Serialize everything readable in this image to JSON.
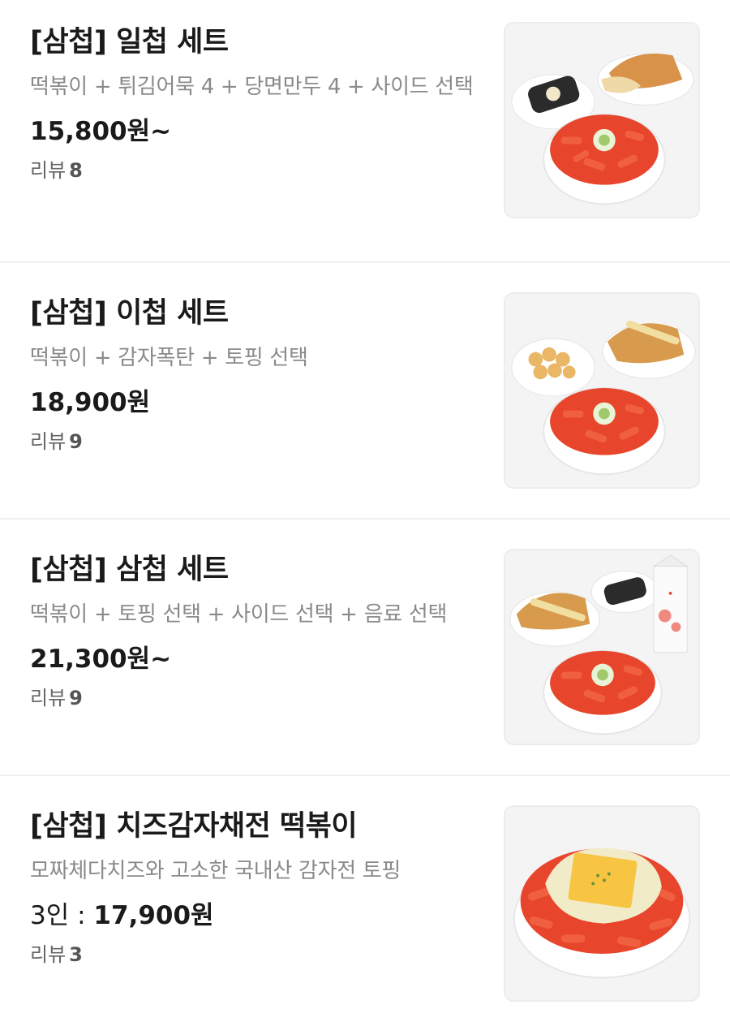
{
  "menu": {
    "items": [
      {
        "name": "[삼첩] 일첩 세트",
        "description": "떡볶이 + 튀김어묵 4 + 당면만두 4 + 사이드 선택",
        "price_prefix": "",
        "price": "15,800원~",
        "reviews_label": "리뷰",
        "reviews_count": "8",
        "image": "tteokbokki-set-with-gimbap-and-dumplings"
      },
      {
        "name": "[삼첩] 이첩 세트",
        "description": "떡볶이 + 감자폭탄 + 토핑 선택",
        "price_prefix": "",
        "price": "18,900원",
        "reviews_label": "리뷰",
        "reviews_count": "9",
        "image": "tteokbokki-set-with-potato-bites-and-fries"
      },
      {
        "name": "[삼첩] 삼첩 세트",
        "description": "떡볶이 + 토핑 선택 + 사이드 선택 + 음료 선택",
        "price_prefix": "",
        "price": "21,300원~",
        "reviews_label": "리뷰",
        "reviews_count": "9",
        "image": "tteokbokki-set-with-drink-carton"
      },
      {
        "name": "[삼첩] 치즈감자채전 떡볶이",
        "description": "모짜체다치즈와 고소한 국내산 감자전 토핑",
        "price_prefix": "3인 : ",
        "price": "17,900원",
        "reviews_label": "리뷰",
        "reviews_count": "3",
        "image": "cheese-potato-pancake-tteokbokki"
      }
    ]
  },
  "colors": {
    "sauce": "#e8462c",
    "bowl": "#ffffff",
    "divider": "#f0f0f0",
    "description": "#8a8a8a"
  }
}
